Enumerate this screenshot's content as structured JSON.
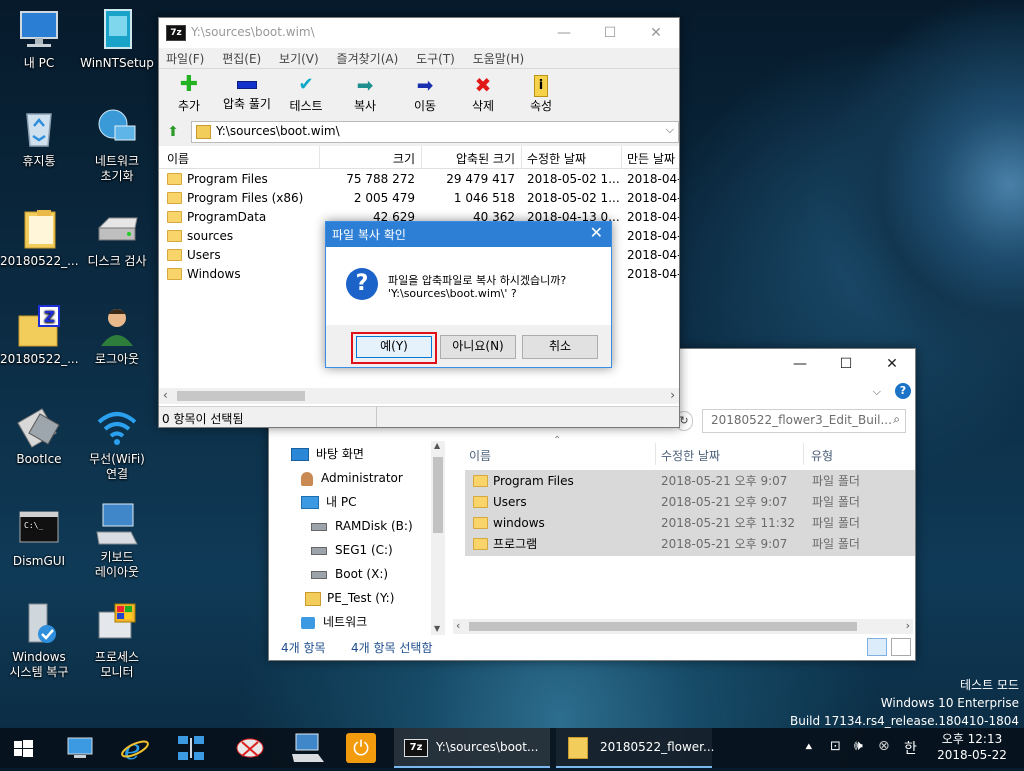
{
  "desktop": {
    "icons": [
      {
        "label1": "내 PC",
        "label2": ""
      },
      {
        "label1": "WinNTSetup",
        "label2": ""
      },
      {
        "label1": "휴지통",
        "label2": ""
      },
      {
        "label1": "네트워크",
        "label2": "초기화"
      },
      {
        "label1": "20180522_...",
        "label2": ""
      },
      {
        "label1": "디스크 검사",
        "label2": ""
      },
      {
        "label1": "20180522_...",
        "label2": ""
      },
      {
        "label1": "로그아웃",
        "label2": ""
      },
      {
        "label1": "BootIce",
        "label2": ""
      },
      {
        "label1": "무선(WiFi)",
        "label2": "연결"
      },
      {
        "label1": "DismGUI",
        "label2": ""
      },
      {
        "label1": "키보드",
        "label2": "레이아웃"
      },
      {
        "label1": "Windows",
        "label2": "시스템 복구"
      },
      {
        "label1": "프로세스",
        "label2": "모니터"
      }
    ],
    "watermark": {
      "line1": "테스트 모드",
      "line2": "Windows 10 Enterprise",
      "line3": "Build 17134.rs4_release.180410-1804"
    }
  },
  "sevenzip": {
    "app_icon": "7z",
    "title": "Y:\\sources\\boot.wim\\",
    "menu": [
      "파일(F)",
      "편집(E)",
      "보기(V)",
      "즐겨찾기(A)",
      "도구(T)",
      "도움말(H)"
    ],
    "toolbar": [
      "추가",
      "압축 풀기",
      "테스트",
      "복사",
      "이동",
      "삭제",
      "속성"
    ],
    "address": "Y:\\sources\\boot.wim\\",
    "columns": [
      "이름",
      "크기",
      "압축된 크기",
      "수정한 날짜",
      "만든 날짜"
    ],
    "rows": [
      {
        "name": "Program Files",
        "size": "75 788 272",
        "packed": "29 479 417",
        "modified": "2018-05-02 1...",
        "created": "2018-04-"
      },
      {
        "name": "Program Files (x86)",
        "size": "2 005 479",
        "packed": "1 046 518",
        "modified": "2018-05-02 1...",
        "created": "2018-04-"
      },
      {
        "name": "ProgramData",
        "size": "42 629",
        "packed": "40 362",
        "modified": "2018-04-13 0...",
        "created": "2018-04-"
      },
      {
        "name": "sources",
        "size": "",
        "packed": "",
        "modified": "",
        "created": "2018-04-"
      },
      {
        "name": "Users",
        "size": "",
        "packed": "",
        "modified": "",
        "created": "2018-04-"
      },
      {
        "name": "Windows",
        "size": "",
        "packed": "",
        "modified": "",
        "created": "2018-04-"
      }
    ],
    "status": "0 항목이 선택됨"
  },
  "dialog": {
    "title": "파일 복사 확인",
    "message": "파일을 압축파일로 복사 하시겠습니까?",
    "path": "'Y:\\sources\\boot.wim\\' ?",
    "yes": "예(Y)",
    "no": "아니요(N)",
    "cancel": "취소"
  },
  "explorer": {
    "search_placeholder": "20180522_flower3_Edit_Buil...",
    "nav": [
      {
        "label": "바탕 화면",
        "indent": 0
      },
      {
        "label": "Administrator",
        "indent": 1
      },
      {
        "label": "내 PC",
        "indent": 1
      },
      {
        "label": "RAMDisk (B:)",
        "indent": 2
      },
      {
        "label": "SEG1 (C:)",
        "indent": 2
      },
      {
        "label": "Boot (X:)",
        "indent": 2
      },
      {
        "label": "PE_Test (Y:)",
        "indent": 2
      },
      {
        "label": "네트워크",
        "indent": 1
      }
    ],
    "columns": [
      "이름",
      "수정한 날짜",
      "유형"
    ],
    "rows": [
      {
        "name": "Program Files",
        "date": "2018-05-21 오후 9:07",
        "type": "파일 폴더"
      },
      {
        "name": "Users",
        "date": "2018-05-21 오후 9:07",
        "type": "파일 폴더"
      },
      {
        "name": "windows",
        "date": "2018-05-21 오후 11:32",
        "type": "파일 폴더"
      },
      {
        "name": "프로그램",
        "date": "2018-05-21 오후 9:07",
        "type": "파일 폴더"
      }
    ],
    "status_count": "4개 항목",
    "status_selected": "4개 항목 선택함"
  },
  "taskbar": {
    "task_7zip": "Y:\\sources\\boot...",
    "task_explorer": "20180522_flower...",
    "ime": "한",
    "time": "오후 12:13",
    "date": "2018-05-22"
  }
}
